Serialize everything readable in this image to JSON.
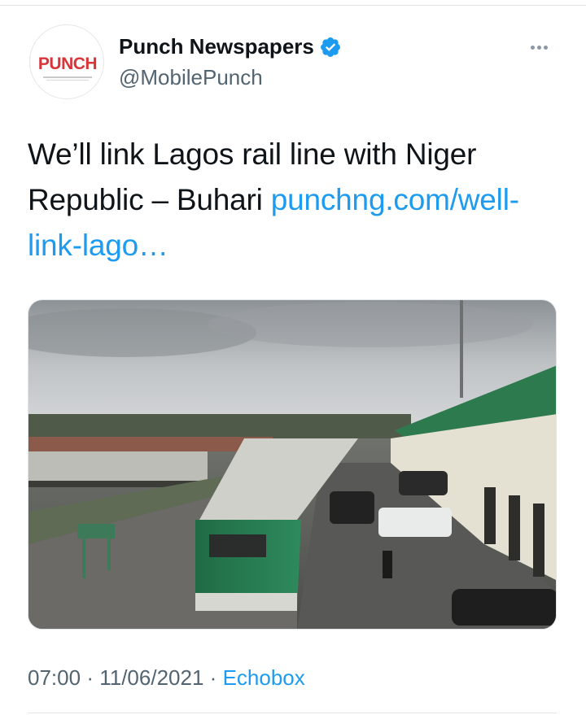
{
  "tweet": {
    "author": {
      "display_name": "Punch Newspapers",
      "handle": "@MobilePunch",
      "avatar_logo_text": "PUNCH",
      "verified": true
    },
    "text": "We’ll link Lagos rail line with Niger Republic – Buhari ",
    "link_text": "punchng.com/well-link-lago…",
    "time": "07:00",
    "separator": "·",
    "date": "11/06/2021",
    "source": "Echobox",
    "icons": {
      "verified": "verified-badge-icon",
      "more": "more-options-icon"
    },
    "colors": {
      "link": "#1d9bf0",
      "secondary": "#536471",
      "verified": "#1d9bf0",
      "logo": "#d8343a"
    }
  }
}
